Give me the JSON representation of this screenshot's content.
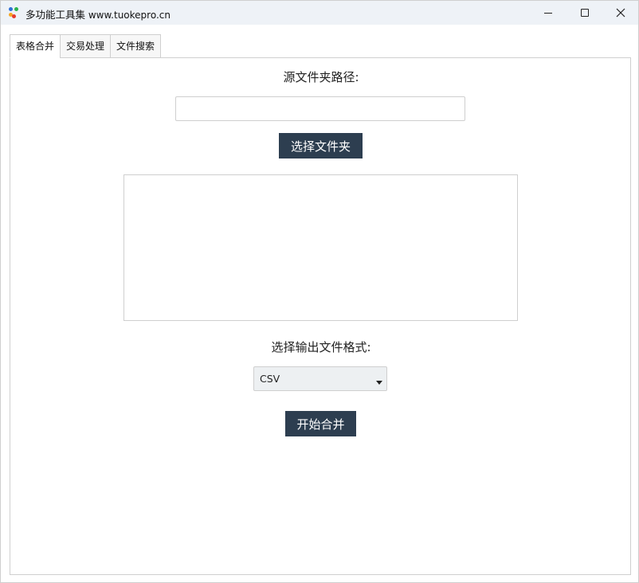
{
  "window": {
    "title": "多功能工具集",
    "title_url": " www.tuokepro.cn",
    "icon_colors": [
      "#2f6fd6",
      "#e63b2e",
      "#f5a623",
      "#2bb24c"
    ]
  },
  "tabs": [
    {
      "label": "表格合并",
      "active": true
    },
    {
      "label": "交易处理",
      "active": false
    },
    {
      "label": "文件搜索",
      "active": false
    }
  ],
  "merge": {
    "source_label": "源文件夹路径:",
    "source_value": "",
    "select_folder_label": "选择文件夹",
    "format_label": "选择输出文件格式:",
    "format_selected": "CSV",
    "start_label": "开始合并"
  },
  "colors": {
    "button_bg": "#2d3e50",
    "titlebar_bg": "#eef2f7"
  }
}
